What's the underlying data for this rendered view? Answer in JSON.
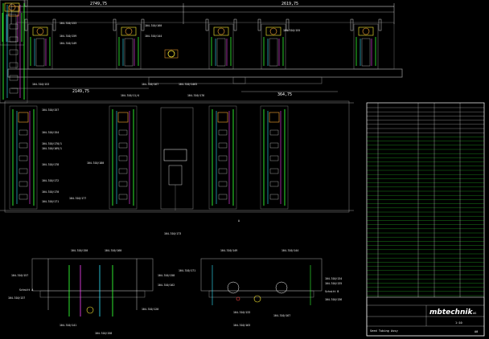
{
  "drawing": {
    "top_dims": [
      "2749,75",
      "2619,75"
    ],
    "bottom_dims": [
      "2149,75",
      "364,75"
    ],
    "section_labels": [
      "Schnitt A",
      "A",
      "Schnitt B"
    ],
    "top_callouts": [
      "104.310/153",
      "104.310/159",
      "104.310/149",
      "104.310/160",
      "104.310/144",
      "104.310/155",
      "104.310/167",
      "104.310/153",
      "104.310/1463"
    ],
    "mid_callouts": [
      "104.310/157",
      "104.310/154",
      "104.310/170/1",
      "104.310/169/1",
      "104.310/172",
      "104.310/170",
      "104.310/171",
      "104.310/178",
      "104.310/177",
      "104.310/11/4",
      "104.310/180",
      "104.310/173",
      "104.310/176"
    ],
    "bottom_callouts": [
      "104.310/150",
      "104.310/160",
      "104.310/157",
      "104.310/158",
      "104.310/162",
      "104.310/137",
      "104.310/141",
      "104.310/158",
      "104.310/120",
      "104.310/149",
      "104.310/144",
      "104.310/171",
      "104.310/134",
      "104.310/135",
      "104.310/136",
      "104.310/133",
      "104.310/167",
      "104.310/163"
    ]
  },
  "title_block": {
    "company": "mbtechnik",
    "company_suffix": "AG",
    "drawing_title": "Seed Tubing Assy",
    "scale": "1:10",
    "sheet": "A0"
  },
  "colors": {
    "background": "#000000",
    "lines": "#ffffff",
    "gray": "#8a8a8a",
    "green": "#33ff33",
    "yellow": "#ffee33",
    "cyan": "#33e6ff",
    "magenta": "#ff44ff",
    "orange": "#ffaa33",
    "red": "#ff4444"
  }
}
